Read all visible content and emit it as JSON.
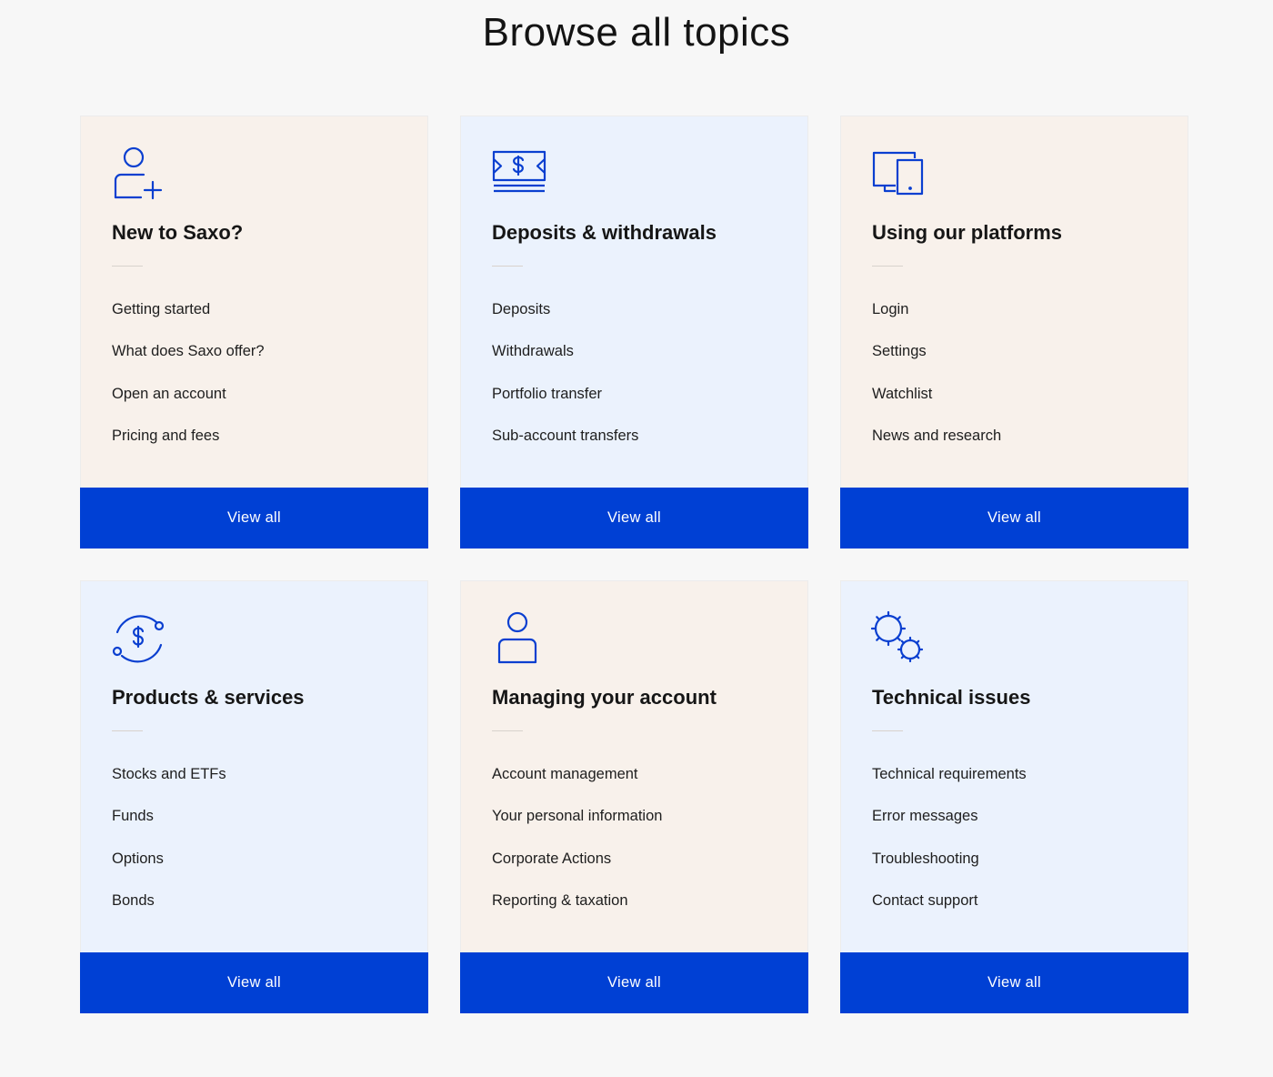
{
  "page": {
    "title": "Browse all topics"
  },
  "colors": {
    "accent": "#0040d4",
    "beige": "#f8f1eb",
    "blue": "#ebf2fd"
  },
  "cards": [
    {
      "title": "New to Saxo?",
      "icon": "user-add-icon",
      "links": [
        "Getting started",
        "What does Saxo offer?",
        "Open an account",
        "Pricing and fees"
      ],
      "button": "View all"
    },
    {
      "title": "Deposits & withdrawals",
      "icon": "banknote-icon",
      "links": [
        "Deposits",
        "Withdrawals",
        "Portfolio transfer",
        "Sub-account transfers"
      ],
      "button": "View all"
    },
    {
      "title": "Using our platforms",
      "icon": "devices-icon",
      "links": [
        "Login",
        "Settings",
        "Watchlist",
        "News and research"
      ],
      "button": "View all"
    },
    {
      "title": "Products & services",
      "icon": "dollar-cycle-icon",
      "links": [
        "Stocks and ETFs",
        "Funds",
        "Options",
        "Bonds"
      ],
      "button": "View all"
    },
    {
      "title": "Managing your account",
      "icon": "user-icon",
      "links": [
        "Account management",
        "Your personal information",
        "Corporate Actions",
        "Reporting & taxation"
      ],
      "button": "View all"
    },
    {
      "title": "Technical issues",
      "icon": "gears-icon",
      "links": [
        "Technical requirements",
        "Error messages",
        "Troubleshooting",
        "Contact support"
      ],
      "button": "View all"
    }
  ]
}
